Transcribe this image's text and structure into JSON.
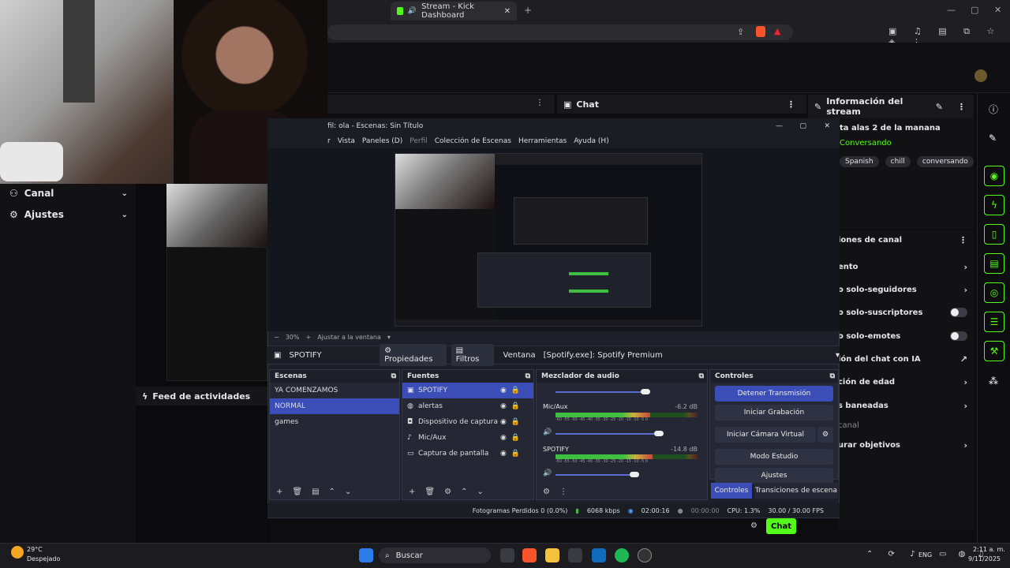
{
  "browser": {
    "tab_title": "Stream - Kick Dashboard"
  },
  "kick": {
    "left_nav": [
      {
        "label": "Canal"
      },
      {
        "label": "Ajustes"
      }
    ],
    "feed_label": "Feed de actividades",
    "chat_panel_title": "Chat",
    "info_panel_title": "Información del stream",
    "stream_title": "ta alas 2 de la manana",
    "category": "Conversando",
    "tags": [
      "Spanish",
      "chill",
      "conversando"
    ],
    "moderation_title": "iones de canal",
    "moderation_rows": [
      {
        "label": "ento",
        "end": "›"
      },
      {
        "label": "o solo-seguidores",
        "end": "›"
      },
      {
        "label": "o solo-suscriptores",
        "end": "toggle"
      },
      {
        "label": "o solo-emotes",
        "end": "toggle"
      },
      {
        "label": "ión del chat con IA",
        "end": "↗"
      },
      {
        "label": "ción de edad",
        "end": "›"
      },
      {
        "label": "s baneadas",
        "end": "›"
      },
      {
        "label": "canal",
        "end": ""
      },
      {
        "label": "urar objetivos",
        "end": "›"
      }
    ],
    "chat_button": "Chat"
  },
  "obs": {
    "title": "fil: ola - Escenas: Sin Título",
    "menu": [
      "r",
      "Vista",
      "Paneles (D)",
      "Perfil",
      "Colección de Escenas",
      "Herramientas",
      "Ayuda (H)"
    ],
    "zoom_label": "30%",
    "fit_label": "Ajustar a la ventana",
    "source_name": "SPOTIFY",
    "properties_label": "Propiedades",
    "filters_label": "Filtros",
    "window_label": "Ventana",
    "window_value": "[Spotify.exe]: Spotify Premium",
    "scenes_title": "Escenas",
    "scenes": [
      "YA COMENZAMOS",
      "NORMAL",
      "games"
    ],
    "sources_title": "Fuentes",
    "sources": [
      {
        "name": "SPOTIFY",
        "icon": "window-icon"
      },
      {
        "name": "alertas",
        "icon": "globe-icon"
      },
      {
        "name": "Dispositivo de captura de v",
        "icon": "camera-icon"
      },
      {
        "name": "Mic/Aux",
        "icon": "mic-icon"
      },
      {
        "name": "Captura de pantalla",
        "icon": "monitor-icon"
      }
    ],
    "mixer_title": "Mezclador de audio",
    "mixer_channels": [
      {
        "name": "Mic/Aux",
        "db": "-6.2 dB"
      },
      {
        "name": "SPOTIFY",
        "db": "-14.8 dB"
      }
    ],
    "meter_scale": "-60 -55 -50 -45 -40 -35 -30 -25 -20 -15 -10 -5 0",
    "controls_title": "Controles",
    "controls": [
      "Detener Transmisión",
      "Iniciar Grabación",
      "Iniciar Cámara Virtual",
      "Modo Estudio",
      "Ajustes"
    ],
    "bottom_tabs": [
      "Controles",
      "Transiciones de escena"
    ],
    "status": {
      "dropped": "Fotogramas Perdidos 0 (0.0%)",
      "bitrate": "6068 kbps",
      "stream_time": "02:00:16",
      "rec_time": "00:00:00",
      "cpu": "CPU: 1.3%",
      "fps": "30.00 / 30.00 FPS"
    }
  },
  "taskbar": {
    "weather_temp": "29°C",
    "weather_desc": "Despejado",
    "search": "Buscar",
    "lang": "ENG",
    "time": "2:11 a. m.",
    "date": "9/11/2025"
  },
  "colors": {
    "kick_green": "#53fc18",
    "obs_accent": "#3b4eb8"
  }
}
